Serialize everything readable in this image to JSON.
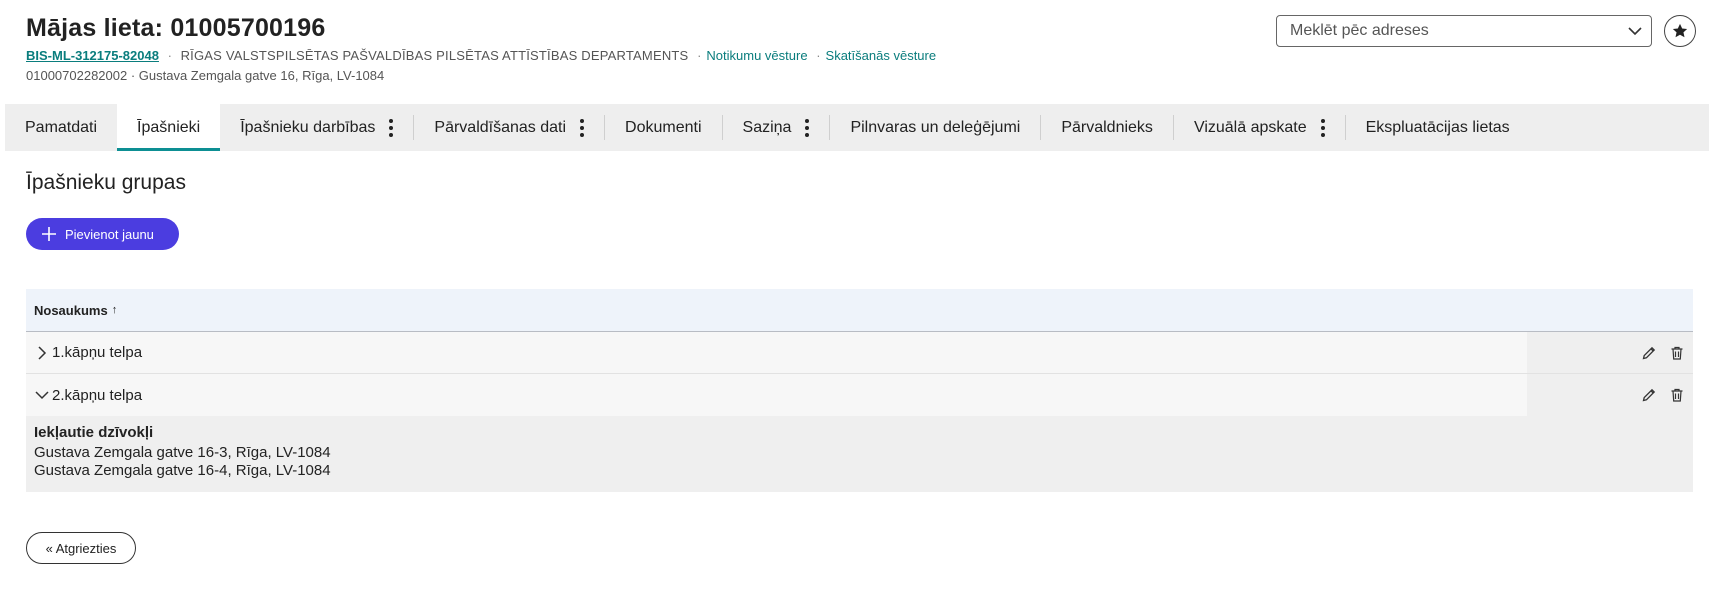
{
  "header": {
    "title": "Mājas lieta: 01005700196",
    "code": "BIS-ML-312175-82048",
    "department": "RĪGAS VALSTSPILSĒTAS PAŠVALDĪBAS PILSĒTAS ATTĪSTĪBAS DEPARTAMENTS",
    "separator": "·",
    "events_link": "Notikumu vēsture",
    "views_link": "Skatīšanās vēsture",
    "address_line": "01000702282002 · Gustava Zemgala gatve 16, Rīga, LV-1084"
  },
  "search": {
    "placeholder": "Meklēt pēc adreses"
  },
  "tabs": [
    {
      "label": "Pamatdati"
    },
    {
      "label": "Īpašnieki"
    },
    {
      "label": "Īpašnieku darbības"
    },
    {
      "label": "Pārvaldīšanas dati"
    },
    {
      "label": "Dokumenti"
    },
    {
      "label": "Saziņa"
    },
    {
      "label": "Pilnvaras un deleģējumi"
    },
    {
      "label": "Pārvaldnieks"
    },
    {
      "label": "Vizuālā apskate"
    },
    {
      "label": "Ekspluatācijas lietas"
    }
  ],
  "section": {
    "title": "Īpašnieku grupas",
    "add_label": "Pievienot jaunu"
  },
  "table": {
    "column": "Nosaukums",
    "sort_indicator": "↑",
    "rows": [
      {
        "name": "1.kāpņu telpa"
      },
      {
        "name": "2.kāpņu telpa"
      }
    ],
    "details": {
      "heading": "Iekļautie dzīvokļi",
      "items": [
        "Gustava Zemgala gatve 16-3, Rīga, LV-1084",
        "Gustava Zemgala gatve 16-4, Rīga, LV-1084"
      ]
    }
  },
  "back_label": "« Atgriezties"
}
